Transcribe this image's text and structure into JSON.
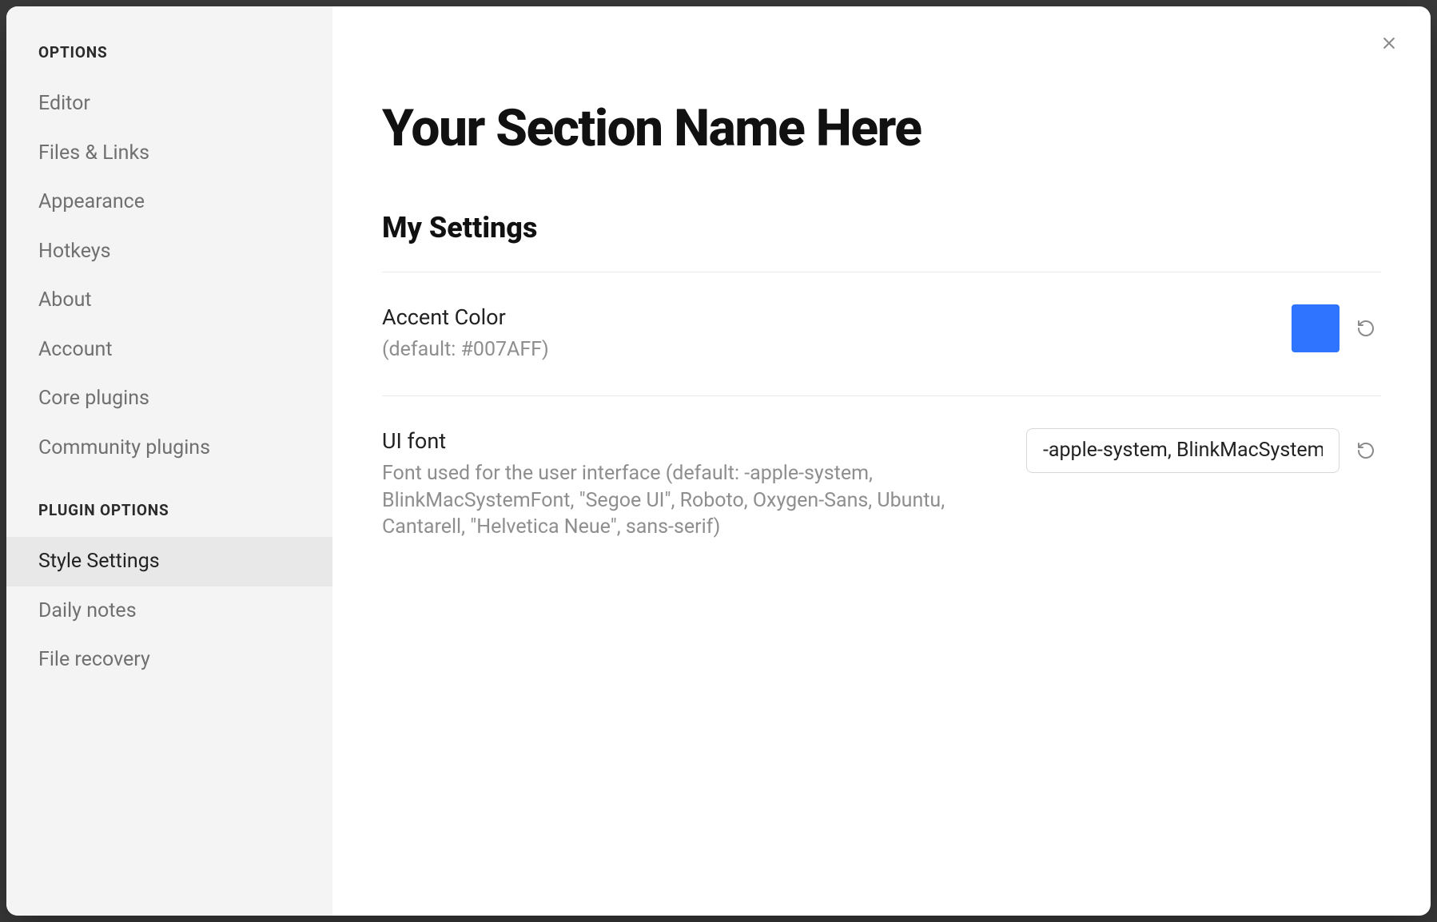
{
  "sidebar": {
    "group1_header": "OPTIONS",
    "group1": [
      "Editor",
      "Files & Links",
      "Appearance",
      "Hotkeys",
      "About",
      "Account",
      "Core plugins",
      "Community plugins"
    ],
    "group2_header": "PLUGIN OPTIONS",
    "group2": [
      "Style Settings",
      "Daily notes",
      "File recovery"
    ],
    "active": "Style Settings"
  },
  "content": {
    "title": "Your Section Name Here",
    "subsection": "My Settings",
    "settings": {
      "accent": {
        "name": "Accent Color",
        "desc": "(default: #007AFF)",
        "color": "#2f74ff"
      },
      "ui_font": {
        "name": "UI font",
        "desc": "Font used for the user interface (default: -apple-system, BlinkMacSystemFont, \"Segoe UI\", Roboto, Oxygen-Sans, Ubuntu, Cantarell, \"Helvetica Neue\", sans-serif)",
        "value": "-apple-system, BlinkMacSystemFont, \"Segoe UI\", Roboto, Oxygen-Sans, Ubuntu, Cantarell, \"Helvetica Neue\", sans-serif"
      }
    }
  }
}
